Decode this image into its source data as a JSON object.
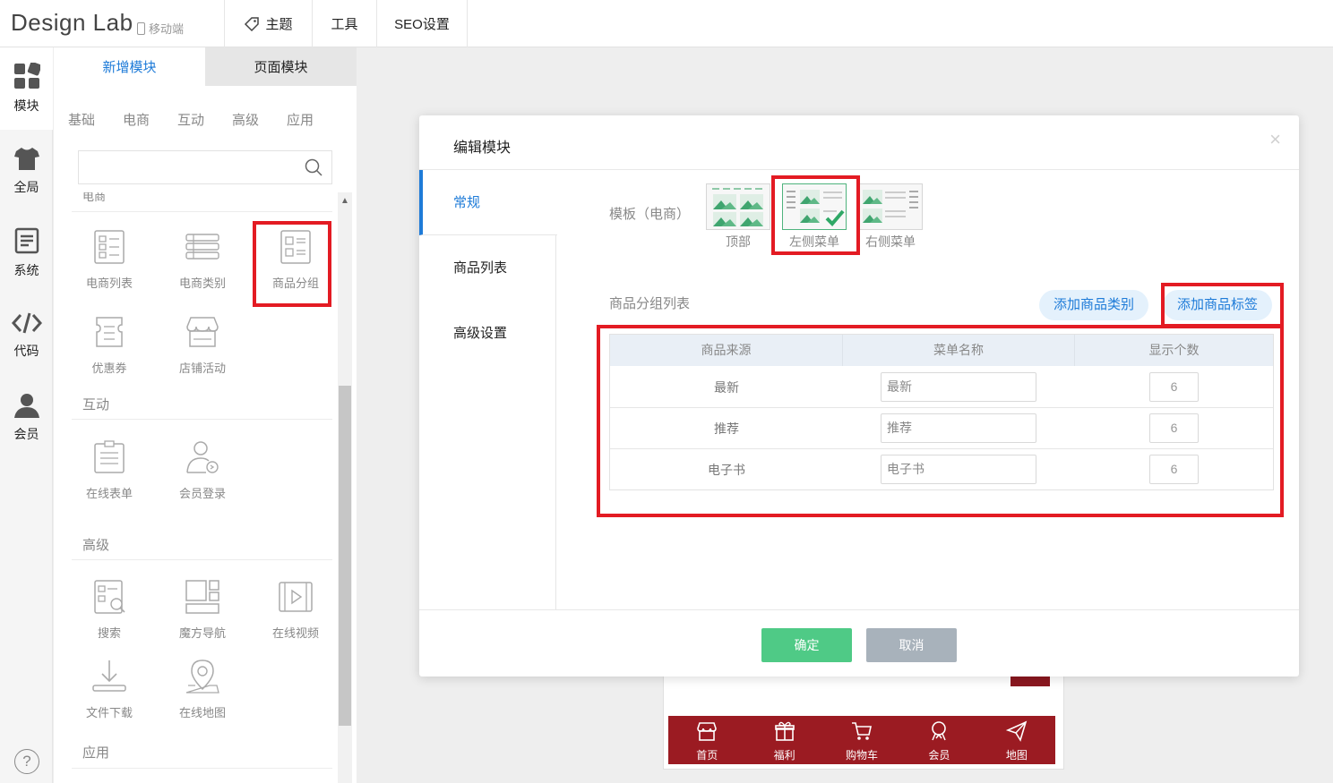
{
  "topbar": {
    "logo": "Design Lab",
    "mobile": "移动端",
    "nav": {
      "theme": "主题",
      "tools": "工具",
      "seo": "SEO设置"
    }
  },
  "rail": [
    {
      "label": "模块",
      "icon": "grid-icon"
    },
    {
      "label": "全局",
      "icon": "shirt-icon"
    },
    {
      "label": "系统",
      "icon": "document-icon"
    },
    {
      "label": "代码",
      "icon": "code-icon"
    },
    {
      "label": "会员",
      "icon": "user-icon"
    }
  ],
  "help": "?",
  "panel": {
    "tab_new": "新增模块",
    "tab_page": "页面模块",
    "categories": [
      "基础",
      "电商",
      "互动",
      "高级",
      "应用"
    ],
    "search_placeholder": "",
    "cut_section": "电商",
    "ecommerce": [
      "电商列表",
      "电商类别",
      "商品分组",
      "优惠券",
      "店铺活动"
    ],
    "interactive_title": "互动",
    "interactive": [
      "在线表单",
      "会员登录"
    ],
    "advanced_title": "高级",
    "advanced": [
      "搜索",
      "魔方导航",
      "在线视频",
      "文件下载",
      "在线地图"
    ],
    "app_title": "应用"
  },
  "footer_nav": [
    "首页",
    "福利",
    "购物车",
    "会员",
    "地图"
  ],
  "modal": {
    "title": "编辑模块",
    "close": "×",
    "side_tabs": [
      "常规",
      "商品列表",
      "高级设置"
    ],
    "template_label": "模板（电商）",
    "templates": [
      "顶部",
      "左侧菜单",
      "右侧菜单"
    ],
    "selected_template": "左侧菜单",
    "group_label": "商品分组列表",
    "add_category": "添加商品类别",
    "add_tag": "添加商品标签",
    "table": {
      "headers": [
        "商品来源",
        "菜单名称",
        "显示个数"
      ],
      "rows": [
        {
          "source": "最新",
          "name": "最新",
          "count": "6"
        },
        {
          "source": "推荐",
          "name": "推荐",
          "count": "6"
        },
        {
          "source": "电子书",
          "name": "电子书",
          "count": "6"
        }
      ]
    },
    "ok": "确定",
    "cancel": "取消"
  },
  "colors": {
    "accent": "#1e7bd8",
    "highlight": "#e31b23",
    "confirm": "#4fca86",
    "cancel": "#a8b2bb",
    "footer": "#9b1b22"
  }
}
